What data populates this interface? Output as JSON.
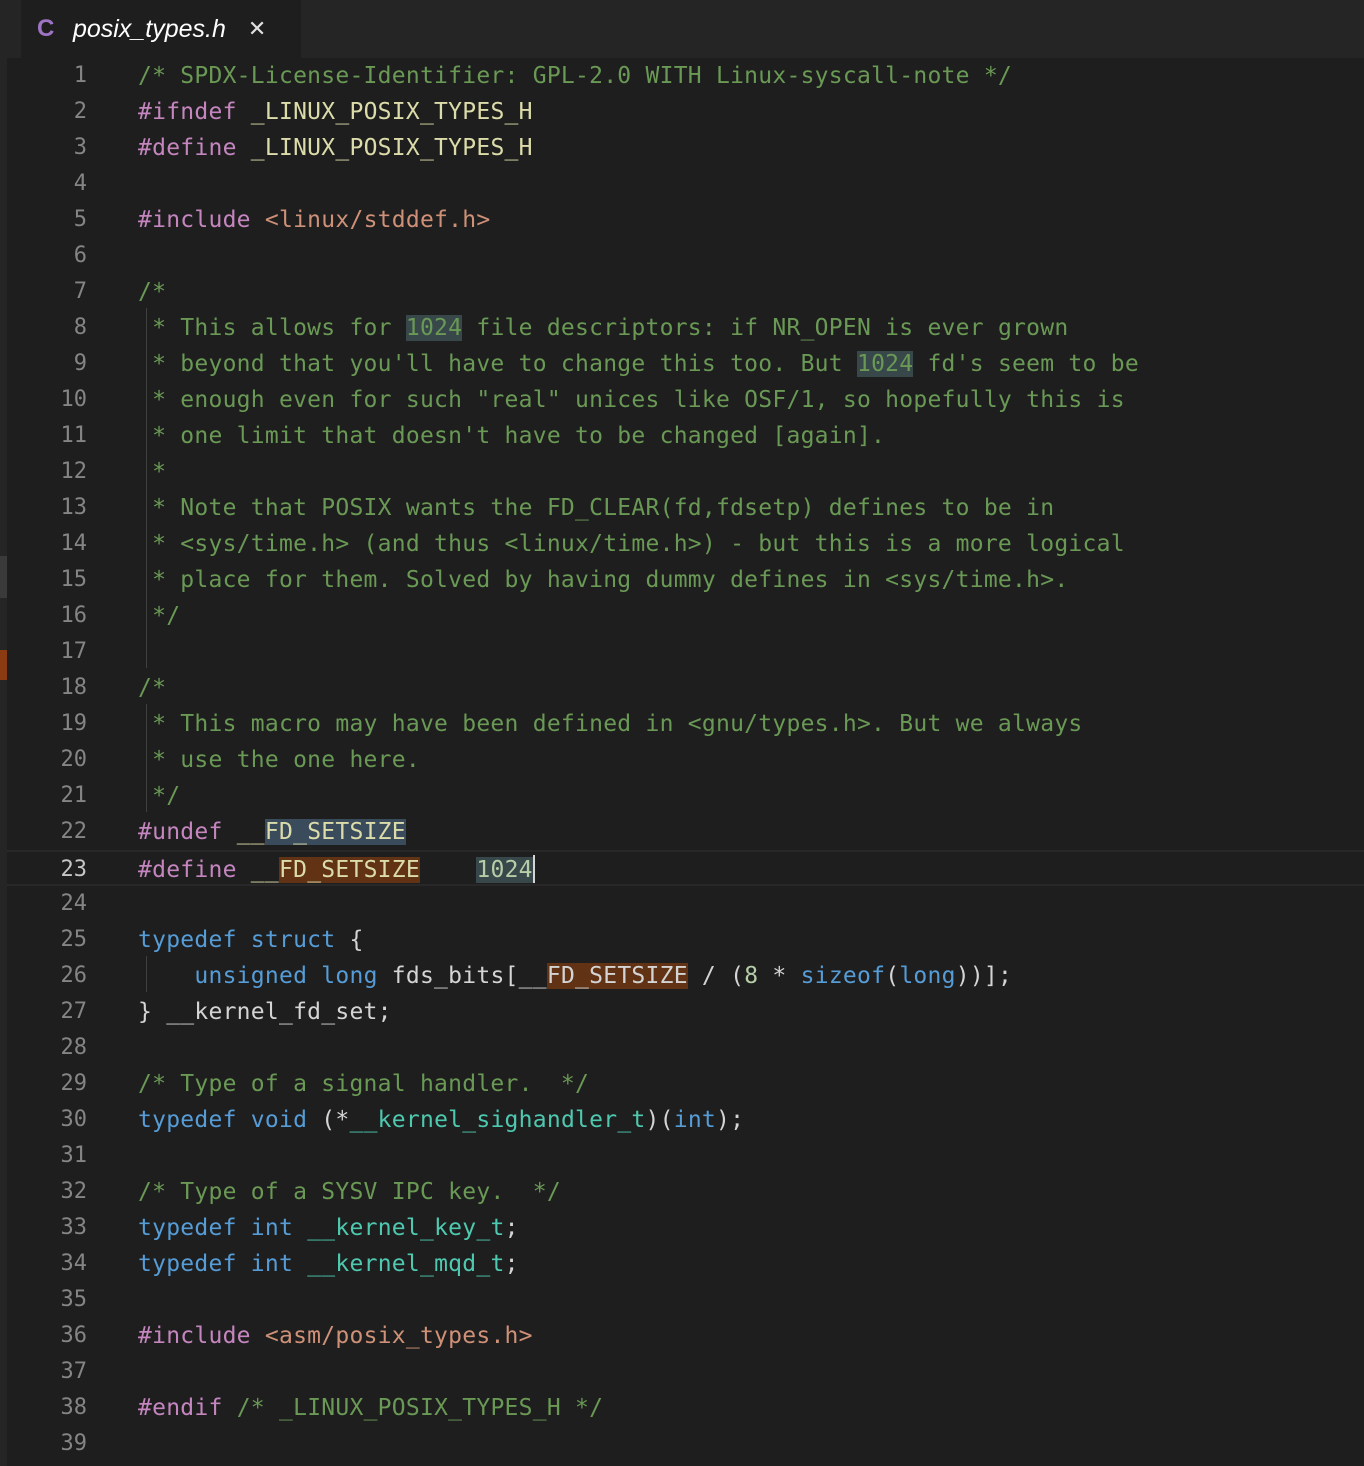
{
  "tab": {
    "icon": "C",
    "title": "posix_types.h",
    "close": "✕"
  },
  "editor": {
    "current_line": 23,
    "lines": [
      {
        "n": "1",
        "t": [
          {
            "c": "cm",
            "s": "/* SPDX-License-Identifier: GPL-2.0 WITH Linux-syscall-note */"
          }
        ]
      },
      {
        "n": "2",
        "t": [
          {
            "c": "pp",
            "s": "#ifndef"
          },
          {
            "c": "id",
            "s": " "
          },
          {
            "c": "mac",
            "s": "_LINUX_POSIX_TYPES_H"
          }
        ]
      },
      {
        "n": "3",
        "t": [
          {
            "c": "pp",
            "s": "#define"
          },
          {
            "c": "id",
            "s": " "
          },
          {
            "c": "mac",
            "s": "_LINUX_POSIX_TYPES_H"
          }
        ]
      },
      {
        "n": "4",
        "t": []
      },
      {
        "n": "5",
        "t": [
          {
            "c": "pp",
            "s": "#include"
          },
          {
            "c": "id",
            "s": " "
          },
          {
            "c": "str",
            "s": "<linux/stddef.h>"
          }
        ]
      },
      {
        "n": "6",
        "t": []
      },
      {
        "n": "7",
        "t": [
          {
            "c": "cm",
            "s": "/*"
          }
        ]
      },
      {
        "n": "8",
        "t": [
          {
            "c": "cm",
            "s": " * This allows for "
          },
          {
            "c": "cm hl-num",
            "s": "1024"
          },
          {
            "c": "cm",
            "s": " file descriptors: if NR_OPEN is ever grown"
          }
        ]
      },
      {
        "n": "9",
        "t": [
          {
            "c": "cm",
            "s": " * beyond that you'll have to change this too. But "
          },
          {
            "c": "cm hl-num",
            "s": "1024"
          },
          {
            "c": "cm",
            "s": " fd's seem to be"
          }
        ]
      },
      {
        "n": "10",
        "t": [
          {
            "c": "cm",
            "s": " * enough even for such \"real\" unices like OSF/1, so hopefully this is"
          }
        ]
      },
      {
        "n": "11",
        "t": [
          {
            "c": "cm",
            "s": " * one limit that doesn't have to be changed [again]."
          }
        ]
      },
      {
        "n": "12",
        "t": [
          {
            "c": "cm",
            "s": " *"
          }
        ]
      },
      {
        "n": "13",
        "t": [
          {
            "c": "cm",
            "s": " * Note that POSIX wants the FD_CLEAR(fd,fdsetp) defines to be in"
          }
        ]
      },
      {
        "n": "14",
        "t": [
          {
            "c": "cm",
            "s": " * <sys/time.h> (and thus <linux/time.h>) - but this is a more logical"
          }
        ]
      },
      {
        "n": "15",
        "t": [
          {
            "c": "cm",
            "s": " * place for them. Solved by having dummy defines in <sys/time.h>."
          }
        ]
      },
      {
        "n": "16",
        "t": [
          {
            "c": "cm",
            "s": " */"
          }
        ]
      },
      {
        "n": "17",
        "t": []
      },
      {
        "n": "18",
        "t": [
          {
            "c": "cm",
            "s": "/*"
          }
        ]
      },
      {
        "n": "19",
        "t": [
          {
            "c": "cm",
            "s": " * This macro may have been defined in <gnu/types.h>. But we always"
          }
        ]
      },
      {
        "n": "20",
        "t": [
          {
            "c": "cm",
            "s": " * use the one here."
          }
        ]
      },
      {
        "n": "21",
        "t": [
          {
            "c": "cm",
            "s": " */"
          }
        ]
      },
      {
        "n": "22",
        "t": [
          {
            "c": "pp",
            "s": "#undef"
          },
          {
            "c": "id",
            "s": " "
          },
          {
            "c": "mac",
            "s": "__"
          },
          {
            "c": "mac hl-sel",
            "s": "FD_SETSIZE"
          }
        ]
      },
      {
        "n": "23",
        "t": [
          {
            "c": "pp",
            "s": "#define"
          },
          {
            "c": "id",
            "s": " "
          },
          {
            "c": "mac",
            "s": "__"
          },
          {
            "c": "mac hl-find",
            "s": "FD_SETSIZE"
          },
          {
            "c": "id",
            "s": "    "
          },
          {
            "c": "num hl-num",
            "s": "1024"
          }
        ]
      },
      {
        "n": "24",
        "t": []
      },
      {
        "n": "25",
        "t": [
          {
            "c": "kw",
            "s": "typedef"
          },
          {
            "c": "id",
            "s": " "
          },
          {
            "c": "kw",
            "s": "struct"
          },
          {
            "c": "id",
            "s": " {"
          }
        ]
      },
      {
        "n": "26",
        "t": [
          {
            "c": "id",
            "s": "    "
          },
          {
            "c": "kw",
            "s": "unsigned"
          },
          {
            "c": "id",
            "s": " "
          },
          {
            "c": "kw",
            "s": "long"
          },
          {
            "c": "id",
            "s": " fds_bits[__"
          },
          {
            "c": "id hl-find",
            "s": "FD_SETSIZE"
          },
          {
            "c": "id",
            "s": " / ("
          },
          {
            "c": "num",
            "s": "8"
          },
          {
            "c": "id",
            "s": " * "
          },
          {
            "c": "kw",
            "s": "sizeof"
          },
          {
            "c": "id",
            "s": "("
          },
          {
            "c": "kw",
            "s": "long"
          },
          {
            "c": "id",
            "s": "))];"
          }
        ]
      },
      {
        "n": "27",
        "t": [
          {
            "c": "id",
            "s": "} __kernel_fd_set;"
          }
        ]
      },
      {
        "n": "28",
        "t": []
      },
      {
        "n": "29",
        "t": [
          {
            "c": "cm",
            "s": "/* Type of a signal handler.  */"
          }
        ]
      },
      {
        "n": "30",
        "t": [
          {
            "c": "kw",
            "s": "typedef"
          },
          {
            "c": "id",
            "s": " "
          },
          {
            "c": "kw",
            "s": "void"
          },
          {
            "c": "id",
            "s": " (*"
          },
          {
            "c": "ty",
            "s": "__kernel_sighandler_t"
          },
          {
            "c": "id",
            "s": ")("
          },
          {
            "c": "kw",
            "s": "int"
          },
          {
            "c": "id",
            "s": ");"
          }
        ]
      },
      {
        "n": "31",
        "t": []
      },
      {
        "n": "32",
        "t": [
          {
            "c": "cm",
            "s": "/* Type of a SYSV IPC key.  */"
          }
        ]
      },
      {
        "n": "33",
        "t": [
          {
            "c": "kw",
            "s": "typedef"
          },
          {
            "c": "id",
            "s": " "
          },
          {
            "c": "kw",
            "s": "int"
          },
          {
            "c": "id",
            "s": " "
          },
          {
            "c": "ty",
            "s": "__kernel_key_t"
          },
          {
            "c": "id",
            "s": ";"
          }
        ]
      },
      {
        "n": "34",
        "t": [
          {
            "c": "kw",
            "s": "typedef"
          },
          {
            "c": "id",
            "s": " "
          },
          {
            "c": "kw",
            "s": "int"
          },
          {
            "c": "id",
            "s": " "
          },
          {
            "c": "ty",
            "s": "__kernel_mqd_t"
          },
          {
            "c": "id",
            "s": ";"
          }
        ]
      },
      {
        "n": "35",
        "t": []
      },
      {
        "n": "36",
        "t": [
          {
            "c": "pp",
            "s": "#include"
          },
          {
            "c": "id",
            "s": " "
          },
          {
            "c": "str",
            "s": "<asm/posix_types.h>"
          }
        ]
      },
      {
        "n": "37",
        "t": []
      },
      {
        "n": "38",
        "t": [
          {
            "c": "pp",
            "s": "#endif"
          },
          {
            "c": "id",
            "s": " "
          },
          {
            "c": "cm",
            "s": "/* _LINUX_POSIX_TYPES_H */"
          }
        ]
      },
      {
        "n": "39",
        "t": []
      }
    ]
  }
}
